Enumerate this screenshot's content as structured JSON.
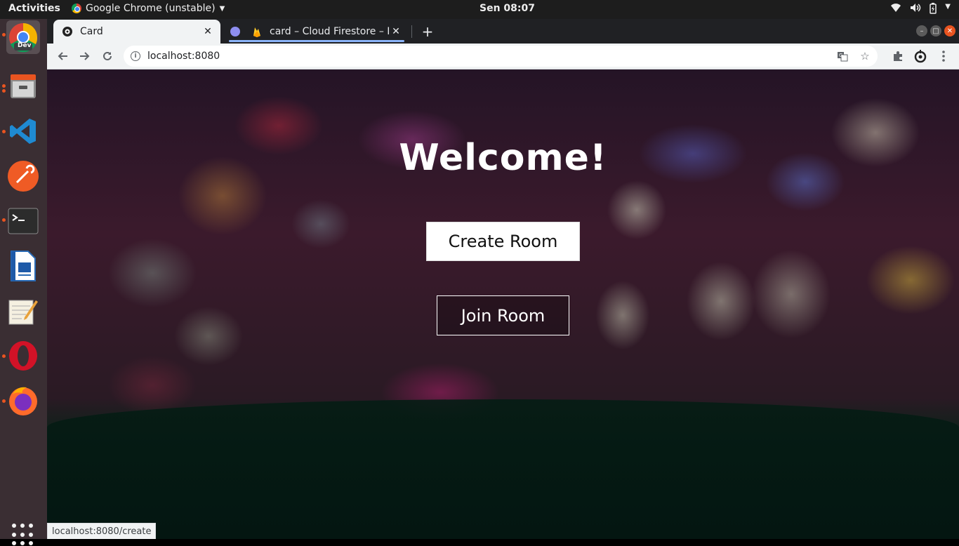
{
  "topbar": {
    "activities": "Activities",
    "app_name": "Google Chrome (unstable)",
    "clock": "Sen 08:07"
  },
  "dock": {
    "items": [
      {
        "name": "chrome-dev",
        "label": "Dev"
      },
      {
        "name": "files"
      },
      {
        "name": "vscode"
      },
      {
        "name": "postman"
      },
      {
        "name": "terminal"
      },
      {
        "name": "libreoffice-writer"
      },
      {
        "name": "text-editor"
      },
      {
        "name": "opera"
      },
      {
        "name": "firefox"
      }
    ]
  },
  "browser": {
    "tabs": [
      {
        "title": "Card",
        "active": true
      },
      {
        "title": "card – Cloud Firestore – Fi",
        "active": false
      }
    ],
    "address": "localhost:8080",
    "status_url": "localhost:8080/create"
  },
  "page": {
    "heading": "Welcome!",
    "create_button": "Create Room",
    "join_button": "Join Room"
  },
  "colors": {
    "accent_underline": "#8ab4f8",
    "dock_dot": "#e95420"
  }
}
